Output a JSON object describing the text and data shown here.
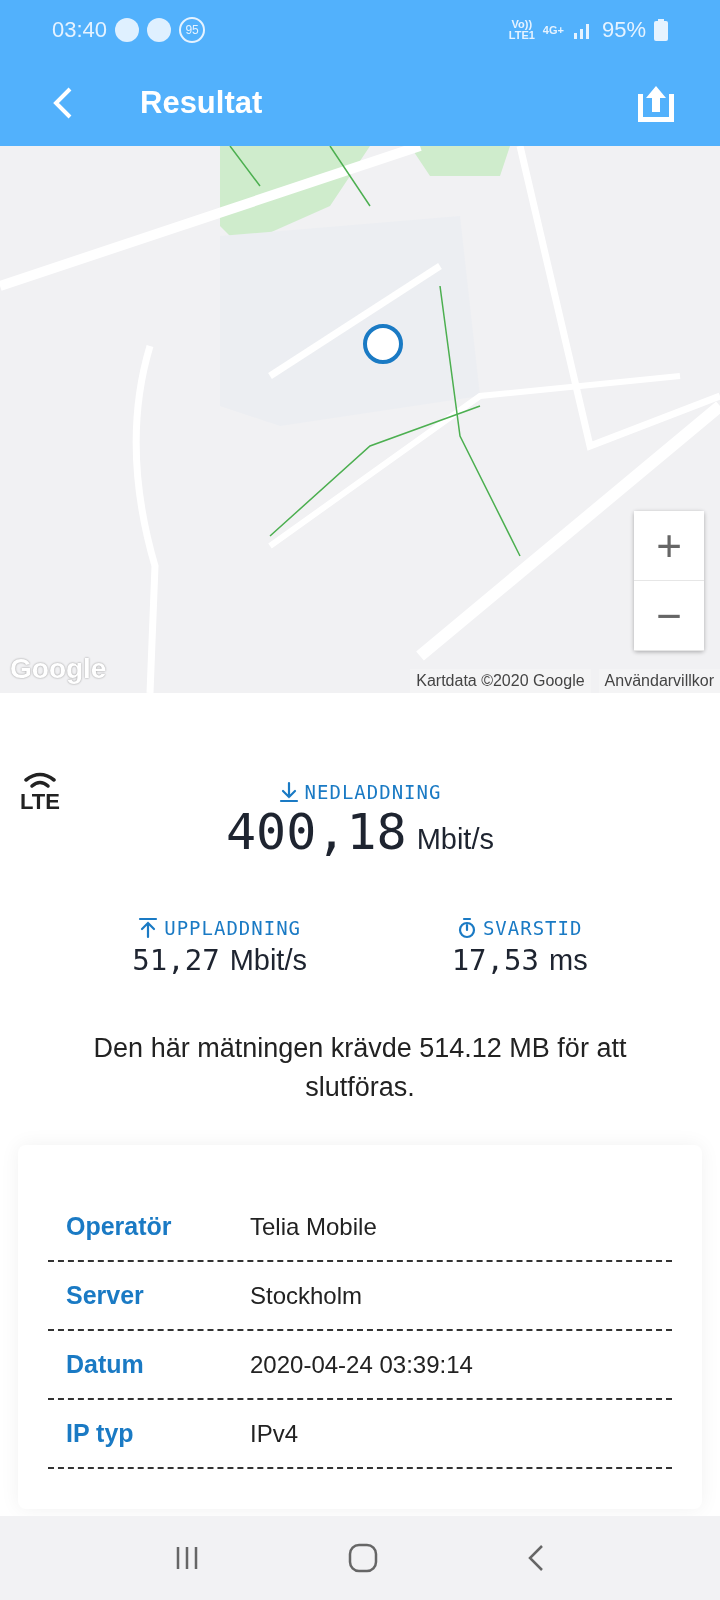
{
  "status_bar": {
    "time": "03:40",
    "notification_badge": "95",
    "volte": "Vo))",
    "volte_sub": "LTE1",
    "network": "4G+",
    "battery": "95%"
  },
  "app_bar": {
    "title": "Resultat"
  },
  "map": {
    "kind": "picture",
    "logo": "Google",
    "attribution": "Kartdata ©2020 Google",
    "terms": "Användarvillkor",
    "zoom_in": "+",
    "zoom_out": "−"
  },
  "result": {
    "network_type": "LTE",
    "download": {
      "label": "NEDLADDNING",
      "value": "400,18",
      "unit": "Mbit/s"
    },
    "upload": {
      "label": "UPPLADDNING",
      "value": "51,27",
      "unit": "Mbit/s"
    },
    "latency": {
      "label": "SVARSTID",
      "value": "17,53",
      "unit": "ms"
    },
    "note": "Den här mätningen krävde 514.12 MB för att slutföras."
  },
  "details": [
    {
      "label": "Operatör",
      "value": "Telia Mobile"
    },
    {
      "label": "Server",
      "value": "Stockholm"
    },
    {
      "label": "Datum",
      "value": "2020-04-24 03:39:14"
    },
    {
      "label": "IP typ",
      "value": "IPv4"
    }
  ]
}
